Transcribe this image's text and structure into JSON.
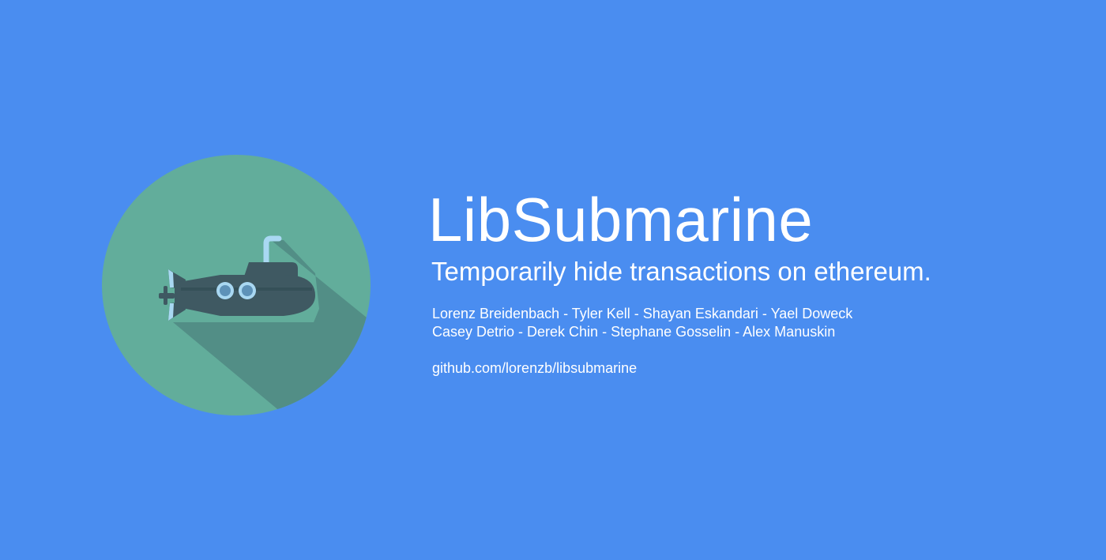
{
  "title": "LibSubmarine",
  "tagline": "Temporarily hide transactions on ethereum.",
  "authors": [
    "Lorenz Breidenbach - Tyler Kell - Shayan Eskandari - Yael Doweck",
    "Casey Detrio - Derek Chin - Stephane Gosselin - Alex Manuskin"
  ],
  "repo_link": "github.com/lorenzb/libsubmarine",
  "logo": {
    "icon": "submarine-icon",
    "circle_color": "#62ad9b",
    "shadow_color": "#528e86",
    "hull_color": "#3f5962",
    "porthole_color": "#a9d8f2"
  },
  "colors": {
    "background": "#4a8df0",
    "text": "#ffffff"
  }
}
